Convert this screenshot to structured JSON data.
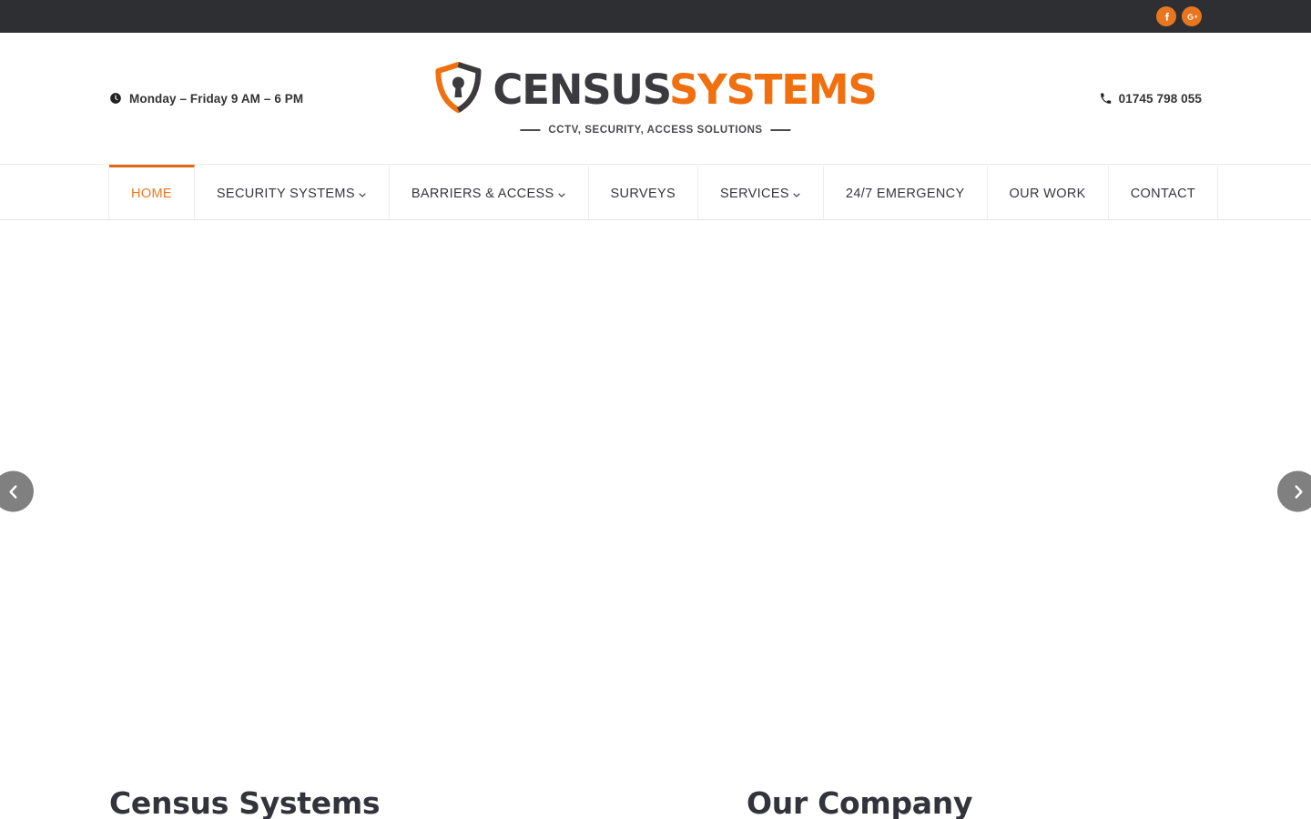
{
  "topbar": {
    "social": [
      {
        "name": "facebook-icon",
        "label": "f"
      },
      {
        "name": "google-plus-icon",
        "label": "G+"
      }
    ]
  },
  "header": {
    "hours": "Monday – Friday 9 AM – 6 PM",
    "hours_icon": "clock-icon",
    "phone": "01745 798 055",
    "phone_icon": "phone-icon",
    "logo": {
      "icon": "shield-keyhole-icon",
      "word_one": "CENSUS",
      "word_two": "SYSTEMS",
      "tagline": "CCTV, SECURITY, ACCESS SOLUTIONS"
    }
  },
  "nav": {
    "items": [
      {
        "label": "HOME",
        "active": true,
        "dropdown": false
      },
      {
        "label": "SECURITY SYSTEMS",
        "active": false,
        "dropdown": true
      },
      {
        "label": "BARRIERS & ACCESS",
        "active": false,
        "dropdown": true
      },
      {
        "label": "SURVEYS",
        "active": false,
        "dropdown": false
      },
      {
        "label": "SERVICES",
        "active": false,
        "dropdown": true
      },
      {
        "label": "24/7 EMERGENCY",
        "active": false,
        "dropdown": false
      },
      {
        "label": "OUR WORK",
        "active": false,
        "dropdown": false
      },
      {
        "label": "CONTACT",
        "active": false,
        "dropdown": false
      }
    ]
  },
  "slider": {
    "prev_label": "Previous slide",
    "next_label": "Next slide"
  },
  "content": {
    "left_title": "Census Systems",
    "right_title": "Our Company"
  },
  "colors": {
    "accent_orange": "#ef7722",
    "logo_orange": "#f07010",
    "topbar_dark": "#2e2f33",
    "heading_dark": "#33333b",
    "arrow_gray": "#808080"
  }
}
